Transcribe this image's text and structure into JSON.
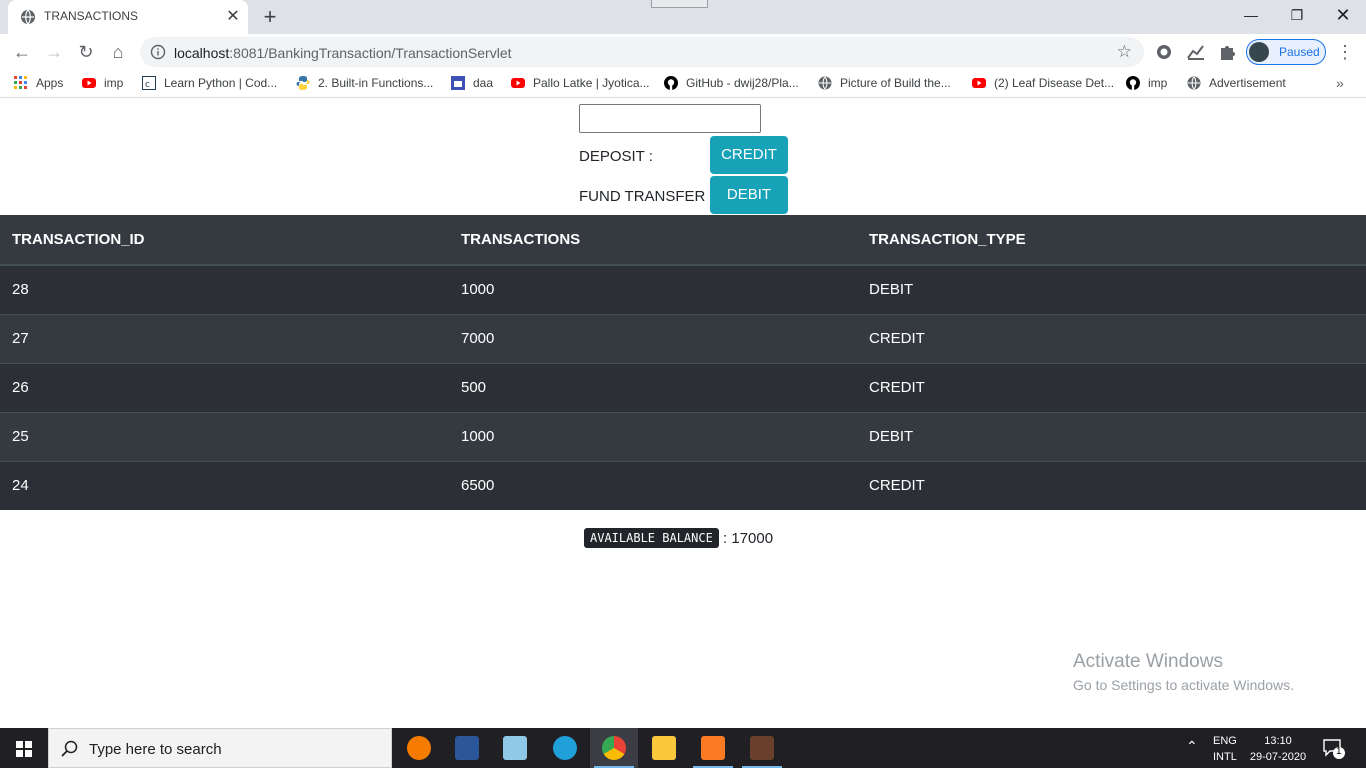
{
  "browser": {
    "tab_title": "TRANSACTIONS",
    "url_host": "localhost",
    "url_rest": ":8081/BankingTransaction/TransactionServlet",
    "profile_label": "Paused"
  },
  "bookmarks": [
    {
      "label": "Apps",
      "icon": "apps-grid-icon"
    },
    {
      "label": "imp",
      "icon": "youtube-icon"
    },
    {
      "label": "Learn Python | Cod...",
      "icon": "codecademy-icon"
    },
    {
      "label": "2. Built-in Functions...",
      "icon": "python-icon"
    },
    {
      "label": "daa",
      "icon": "site-icon"
    },
    {
      "label": "Pallo Latke | Jyotica...",
      "icon": "youtube-icon"
    },
    {
      "label": "GitHub - dwij28/Pla...",
      "icon": "github-icon"
    },
    {
      "label": "Picture of Build the...",
      "icon": "globe-icon"
    },
    {
      "label": "(2) Leaf Disease Det...",
      "icon": "youtube-icon"
    },
    {
      "label": "imp",
      "icon": "github-icon"
    },
    {
      "label": "Advertisement",
      "icon": "globe-icon"
    }
  ],
  "form": {
    "amount_value": "",
    "deposit_label": "DEPOSIT :",
    "credit_button": "CREDIT",
    "transfer_label": "FUND TRANSFER :",
    "debit_button": "DEBIT"
  },
  "table": {
    "headers": [
      "TRANSACTION_ID",
      "TRANSACTIONS",
      "TRANSACTION_TYPE"
    ],
    "rows": [
      [
        "28",
        "1000",
        "DEBIT"
      ],
      [
        "27",
        "7000",
        "CREDIT"
      ],
      [
        "26",
        "500",
        "CREDIT"
      ],
      [
        "25",
        "1000",
        "DEBIT"
      ],
      [
        "24",
        "6500",
        "CREDIT"
      ]
    ]
  },
  "balance": {
    "label": "AVAILABLE BALANCE",
    "value": ": 17000"
  },
  "watermark": {
    "line1": "Activate Windows",
    "line2": "Go to Settings to activate Windows."
  },
  "taskbar": {
    "search_placeholder": "Type here to search",
    "lang_line1": "ENG",
    "lang_line2": "INTL",
    "time": "13:10",
    "date": "29-07-2020",
    "notification_count": "1",
    "apps": [
      "vlc-icon",
      "word-icon",
      "notepad-icon",
      "edge-icon",
      "chrome-icon",
      "file-explorer-icon",
      "xampp-icon",
      "ide-icon"
    ]
  },
  "colors": {
    "accent_button": "#17a2b8",
    "table_dark": "#343a40",
    "table_stripe": "#2c3036"
  }
}
